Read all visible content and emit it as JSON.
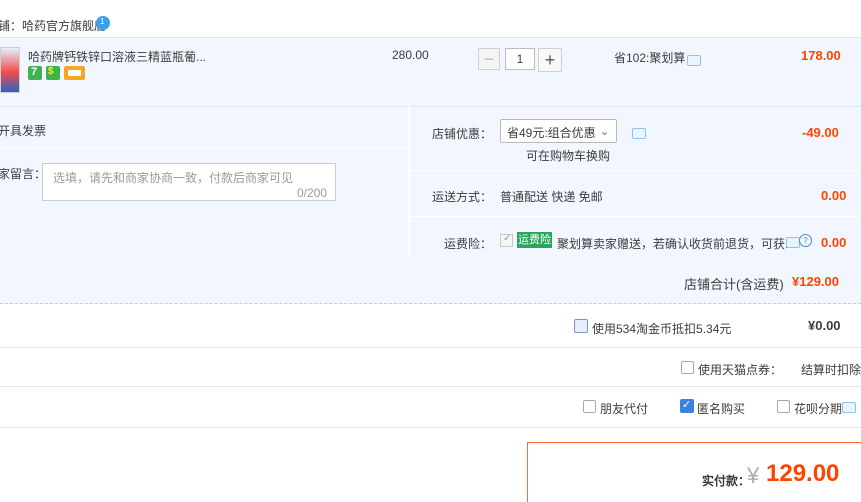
{
  "store": {
    "name": "铺：哈药官方旗舰店",
    "ww_badge": "1"
  },
  "item": {
    "title": "哈药牌钙铁锌口溶液三精蓝瓶葡...",
    "unit_price": "280.00",
    "quantity": "1",
    "minus_label": "−",
    "plus_label": "+",
    "promo": "省102:聚划算",
    "total": "178.00",
    "badges": [
      "7",
      "$"
    ]
  },
  "options": {
    "invoice_label": "开具发票",
    "message_label": "家留言：",
    "message_placeholder": "选填，请先和商家协商一致，付款后商家可见",
    "message_count": "0/200",
    "discount_label": "店铺优惠：",
    "discount_selected": "省49元:组合优惠",
    "discount_sub": "可在购物车换购",
    "discount_amount": "-49.00",
    "shipping_label": "运送方式：",
    "shipping_method": "普通配送 快递 免邮",
    "shipping_amount": "0.00",
    "insurance_label": "运费险：",
    "insurance_badge": "运费险",
    "insurance_text": "聚划算卖家赠送，若确认收货前退货，可获...",
    "insurance_amount": "0.00"
  },
  "shop_total": {
    "label": "店铺合计(含运费)",
    "amount": "¥129.00"
  },
  "coins": {
    "label": "使用534淘金币抵扣5.34元",
    "amount": "¥0.00"
  },
  "tmall": {
    "label": "使用天猫点券：",
    "note": "结算时扣除"
  },
  "checkout_options": {
    "friend": "朋友代付",
    "anonymous": "匿名购买",
    "huabei": "花呗分期"
  },
  "payment": {
    "label": "实付款：",
    "currency": "¥",
    "amount": "129.00"
  },
  "colors": {
    "price": "#ff4400",
    "panel_bg": "#f2f7ff",
    "insurance_badge": "#2aa55a",
    "checkbox_checked": "#3b82e0"
  }
}
